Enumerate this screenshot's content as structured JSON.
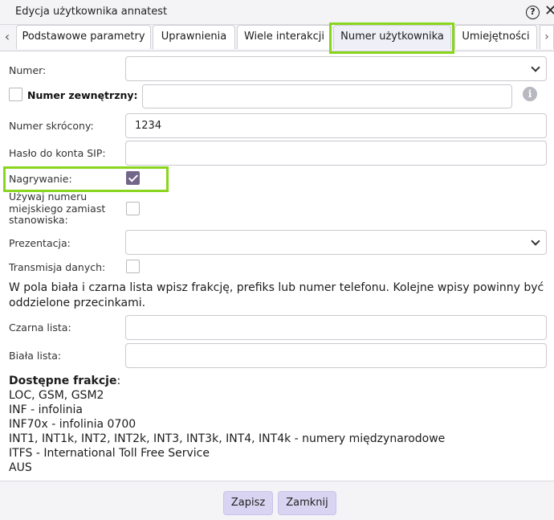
{
  "window": {
    "title": "Edycja użytkownika annatest",
    "help_icon": "help-icon",
    "close_icon": "close-icon",
    "help_glyph": "?",
    "close_glyph": "✕"
  },
  "tabs": [
    {
      "label": "Podstawowe parametry",
      "active": false
    },
    {
      "label": "Uprawnienia",
      "active": false
    },
    {
      "label": "Wiele interakcji",
      "active": false
    },
    {
      "label": "Numer użytkownika",
      "active": true
    },
    {
      "label": "Umiejętności",
      "active": false
    }
  ],
  "tab_scroll": {
    "left_glyph": "‹",
    "right_glyph": "›"
  },
  "form": {
    "numer": {
      "label": "Numer:",
      "value": ""
    },
    "numer_zewnetrzny": {
      "label": "Numer zewnętrzny:",
      "checked": false,
      "value": "",
      "info_glyph": "i"
    },
    "numer_skrocony": {
      "label": "Numer skrócony:",
      "value": "1234"
    },
    "haslo_sip": {
      "label": "Hasło do konta SIP:",
      "value": ""
    },
    "nagrywanie": {
      "label": "Nagrywanie:",
      "checked": true
    },
    "uzywaj_numeru": {
      "label_lines": [
        "Używaj numeru",
        "miejskiego zamiast",
        "stanowiska:"
      ],
      "checked": false
    },
    "prezentacja": {
      "label": "Prezentacja:",
      "value": ""
    },
    "transmisja": {
      "label": "Transmisja danych:",
      "checked": false
    },
    "note": "W pola biała i czarna lista wpisz frakcję, prefiks lub numer telefonu. Kolejne wpisy powinny być oddzielone przecinkami.",
    "czarna_lista": {
      "label": "Czarna lista:",
      "value": ""
    },
    "biala_lista": {
      "label": "Biała lista:",
      "value": ""
    }
  },
  "fractions": {
    "heading": "Dostępne frakcje",
    "heading_suffix": ":",
    "lines": [
      "LOC, GSM, GSM2",
      "INF - infolinia",
      "INF70x - infolinia 0700",
      "INT1, INT1k, INT2, INT2k, INT3, INT3k, INT4, INT4k - numery międzynarodowe",
      "ITFS - International Toll Free Service",
      "AUS"
    ]
  },
  "footer": {
    "save_label": "Zapisz",
    "close_label": "Zamknij"
  },
  "colors": {
    "highlight": "#8ad61e",
    "checkbox_checked": "#726689",
    "button_bg": "#d9d4f1"
  }
}
